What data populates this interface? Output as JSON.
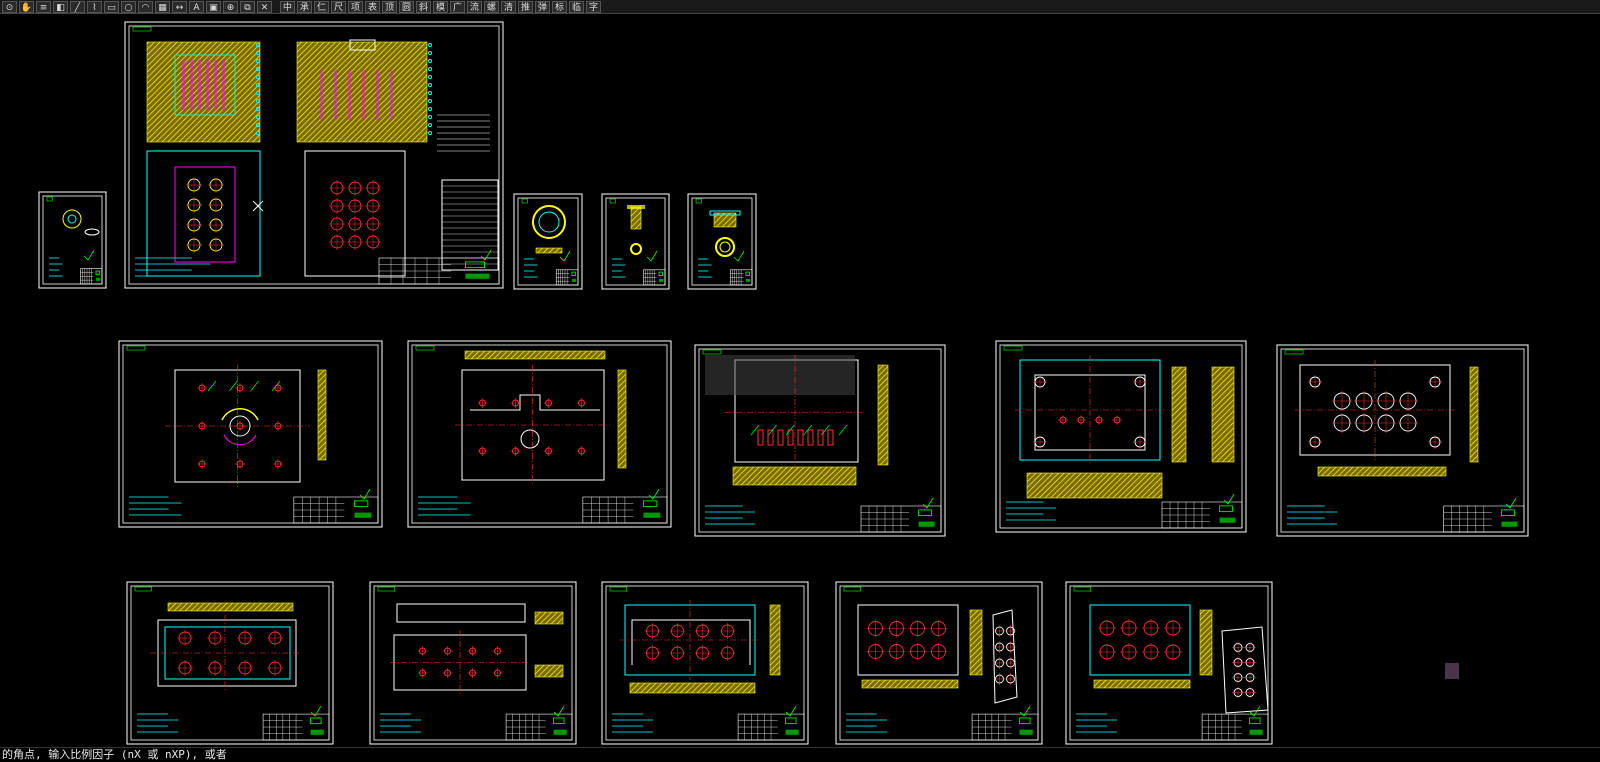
{
  "toolbar": {
    "buttons": [
      {
        "id": "zoom",
        "glyph": "⊙"
      },
      {
        "id": "pan",
        "glyph": "✋"
      },
      {
        "id": "layer",
        "glyph": "≡"
      },
      {
        "id": "match",
        "glyph": "◧"
      },
      {
        "id": "line",
        "glyph": "╱"
      },
      {
        "id": "pline",
        "glyph": "⌇"
      },
      {
        "id": "rect",
        "glyph": "▭"
      },
      {
        "id": "circle",
        "glyph": "○"
      },
      {
        "id": "arc",
        "glyph": "◠"
      },
      {
        "id": "hatch",
        "glyph": "▦"
      },
      {
        "id": "dim",
        "glyph": "↔"
      },
      {
        "id": "text",
        "glyph": "A"
      },
      {
        "id": "block",
        "glyph": "▣"
      },
      {
        "id": "insert",
        "glyph": "⊕"
      },
      {
        "id": "copy",
        "glyph": "⧉"
      },
      {
        "id": "erase",
        "glyph": "✕"
      }
    ],
    "tools": [
      {
        "id": "tool-zhong",
        "glyph": "中"
      },
      {
        "id": "tool-cheng",
        "glyph": "承"
      },
      {
        "id": "tool-ren",
        "glyph": "仁"
      },
      {
        "id": "tool-chi",
        "glyph": "尺"
      },
      {
        "id": "tool-xiang",
        "glyph": "项"
      },
      {
        "id": "tool-biao",
        "glyph": "表"
      },
      {
        "id": "tool-ding",
        "glyph": "顶"
      },
      {
        "id": "tool-hu",
        "glyph": "圆"
      },
      {
        "id": "tool-xie",
        "glyph": "斜"
      },
      {
        "id": "tool-mo",
        "glyph": "模"
      },
      {
        "id": "tool-guang",
        "glyph": "广"
      },
      {
        "id": "tool-liu",
        "glyph": "流"
      },
      {
        "id": "tool-dao",
        "glyph": "螺"
      },
      {
        "id": "tool-qing",
        "glyph": "清"
      },
      {
        "id": "tool-jie",
        "glyph": "推"
      },
      {
        "id": "tool-tan",
        "glyph": "弹"
      },
      {
        "id": "tool-biao2",
        "glyph": "标"
      },
      {
        "id": "tool-lin",
        "glyph": "临"
      },
      {
        "id": "tool-zi",
        "glyph": "字"
      }
    ]
  },
  "drawing": {
    "background": "#000000",
    "frame_color": "#ffffff",
    "colors": {
      "cyan": "#00ffff",
      "yellow": "#ffff00",
      "hatch": "#c8a000",
      "red": "#ff3030",
      "green": "#00ff00",
      "magenta": "#ff00ff",
      "white": "#ffffff",
      "blue": "#4488ff"
    },
    "sheets": [
      {
        "kind": "assembly"
      },
      {
        "kind": "small-part"
      },
      {
        "kind": "ring-part"
      },
      {
        "kind": "pin-part"
      },
      {
        "kind": "bush-part"
      },
      {
        "kind": "plate-center"
      },
      {
        "kind": "plate-holes"
      },
      {
        "kind": "plate-cavity"
      },
      {
        "kind": "plate-frame"
      },
      {
        "kind": "plate-cavities-6"
      },
      {
        "kind": "plate-side"
      },
      {
        "kind": "plate-long"
      },
      {
        "kind": "plate-cavity-2"
      },
      {
        "kind": "plate-8cav-3d"
      },
      {
        "kind": "plate-8cav-3d-2"
      }
    ]
  },
  "command_line": {
    "prompt": "的角点, 输入比例因子 (nX 或 nXP), 或者"
  }
}
